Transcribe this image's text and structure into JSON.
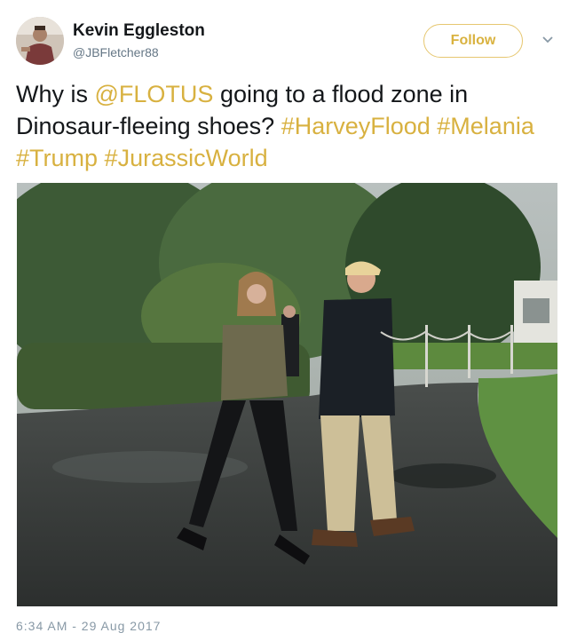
{
  "author": {
    "name": "Kevin Eggleston",
    "handle": "@JBFletcher88",
    "avatar_icon": "profile-photo"
  },
  "follow_button": {
    "label": "Follow"
  },
  "menu": {
    "icon": "chevron-down-icon"
  },
  "tweet": {
    "segments": [
      {
        "text": "Why is ",
        "highlight": false
      },
      {
        "text": "@FLOTUS",
        "highlight": true
      },
      {
        "text": " going to a flood zone in Dinosaur-fleeing shoes? ",
        "highlight": false
      },
      {
        "text": "#HarveyFlood",
        "highlight": true
      },
      {
        "text": " ",
        "highlight": false
      },
      {
        "text": "#Melania",
        "highlight": true
      },
      {
        "text": " ",
        "highlight": false
      },
      {
        "text": "#Trump",
        "highlight": true
      },
      {
        "text": " ",
        "highlight": false
      },
      {
        "text": "#JurassicWorld",
        "highlight": true
      }
    ]
  },
  "timestamp": "6:34 AM - 29 Aug 2017",
  "colors": {
    "accent": "#d8b140",
    "name": "#14171a",
    "muted": "#657786"
  }
}
